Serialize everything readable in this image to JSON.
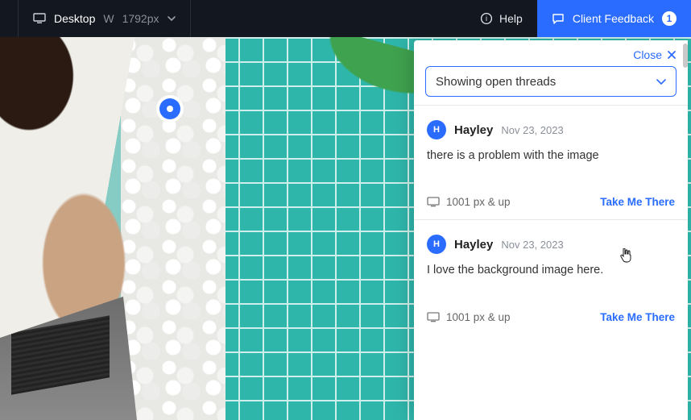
{
  "topbar": {
    "device_label": "Desktop",
    "width_prefix": "W",
    "width_value": "1792px",
    "help_label": "Help",
    "feedback_label": "Client Feedback",
    "feedback_count": "1"
  },
  "panel": {
    "close_label": "Close",
    "filter_label": "Showing open threads"
  },
  "threads": [
    {
      "avatar_initial": "H",
      "author": "Hayley",
      "date": "Nov 23, 2023",
      "message": "there is a problem with the image",
      "breakpoint": "1001 px & up",
      "action": "Take Me There"
    },
    {
      "avatar_initial": "H",
      "author": "Hayley",
      "date": "Nov 23, 2023",
      "message": "I love the background image here.",
      "breakpoint": "1001 px & up",
      "action": "Take Me There"
    }
  ]
}
